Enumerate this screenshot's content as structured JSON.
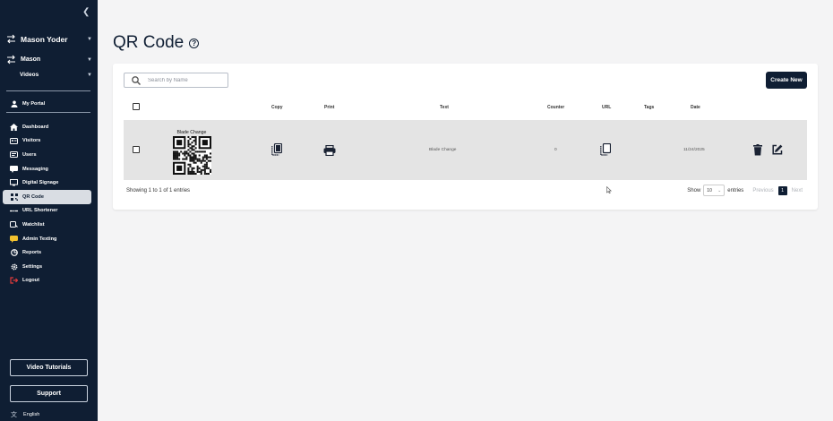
{
  "sidebar": {
    "user_name": "Mason Yoder",
    "location": "Mason",
    "module": "Videos",
    "portal_label": "My Portal",
    "nav": [
      {
        "label": "Dashboard",
        "icon": "home-icon"
      },
      {
        "label": "Visitors",
        "icon": "visitors-icon"
      },
      {
        "label": "Users",
        "icon": "users-icon"
      },
      {
        "label": "Messaging",
        "icon": "messaging-icon"
      },
      {
        "label": "Digital Signage",
        "icon": "monitor-icon"
      },
      {
        "label": "QR Code",
        "icon": "qr-icon",
        "active": true
      },
      {
        "label": "URL Shortener",
        "icon": "link-icon"
      },
      {
        "label": "Watchlist",
        "icon": "watchlist-icon"
      },
      {
        "label": "Admin Texting",
        "icon": "chat-icon"
      },
      {
        "label": "Reports",
        "icon": "reports-icon"
      },
      {
        "label": "Settings",
        "icon": "gear-icon"
      },
      {
        "label": "Logout",
        "icon": "logout-icon"
      }
    ],
    "video_tutorials": "Video Tutorials",
    "support": "Support",
    "language": "English"
  },
  "page": {
    "title": "QR Code"
  },
  "toolbar": {
    "search_placeholder": "Search by Name",
    "create_new": "Create New"
  },
  "table": {
    "headers": {
      "copy": "Copy",
      "print": "Print",
      "text": "Text",
      "counter": "Counter",
      "url": "URL",
      "tags": "Tags",
      "date": "Date"
    },
    "rows": [
      {
        "qr_label": "Blade Change",
        "text": "Blade Change",
        "counter": "0",
        "tags": "",
        "date": "11/24/2025"
      }
    ]
  },
  "footer": {
    "info": "Showing 1 to 1 of 1 entries",
    "show_label": "Show",
    "page_size": "10",
    "entries_label": "entries",
    "previous": "Previous",
    "current_page": "1",
    "next": "Next"
  },
  "colors": {
    "sidebar_bg": "#0f1e33",
    "accent": "#0f1e33",
    "row_bg": "#e4e4e4",
    "page_bg": "#f4f4f5"
  }
}
